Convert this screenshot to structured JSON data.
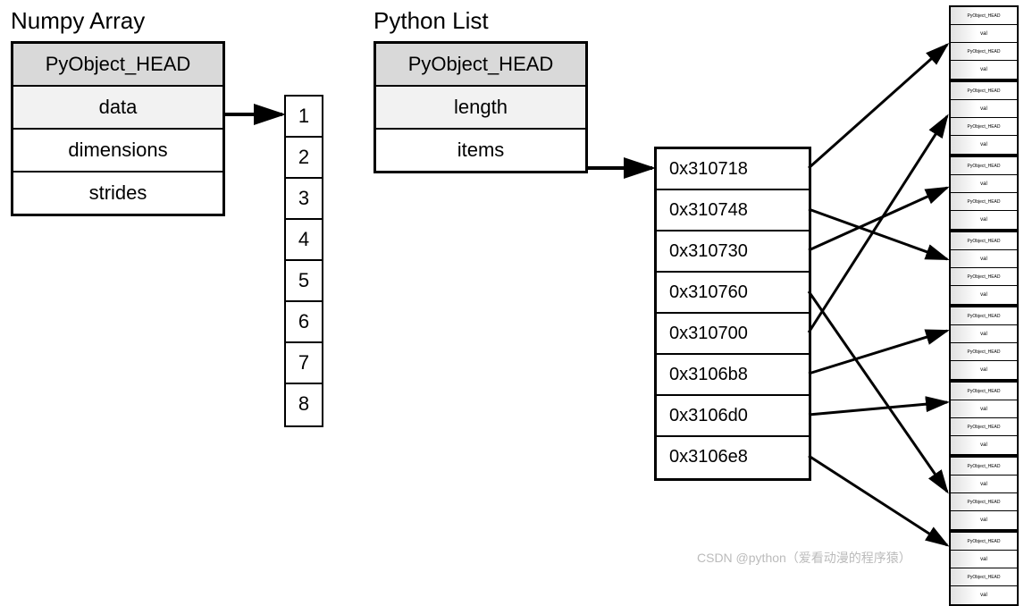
{
  "numpy": {
    "title": "Numpy Array",
    "header": "PyObject_HEAD",
    "rows": [
      "data",
      "dimensions",
      "strides"
    ],
    "data_cells": [
      "1",
      "2",
      "3",
      "4",
      "5",
      "6",
      "7",
      "8"
    ]
  },
  "pylist": {
    "title": "Python List",
    "header": "PyObject_HEAD",
    "rows": [
      "length",
      "items"
    ],
    "pointers": [
      "0x310718",
      "0x310748",
      "0x310730",
      "0x310760",
      "0x310700",
      "0x3106b8",
      "0x3106d0",
      "0x3106e8"
    ]
  },
  "pyobj": {
    "header": "PyObject_HEAD",
    "val": "val"
  },
  "watermark": "CSDN @python（爱看动漫的程序猿）"
}
